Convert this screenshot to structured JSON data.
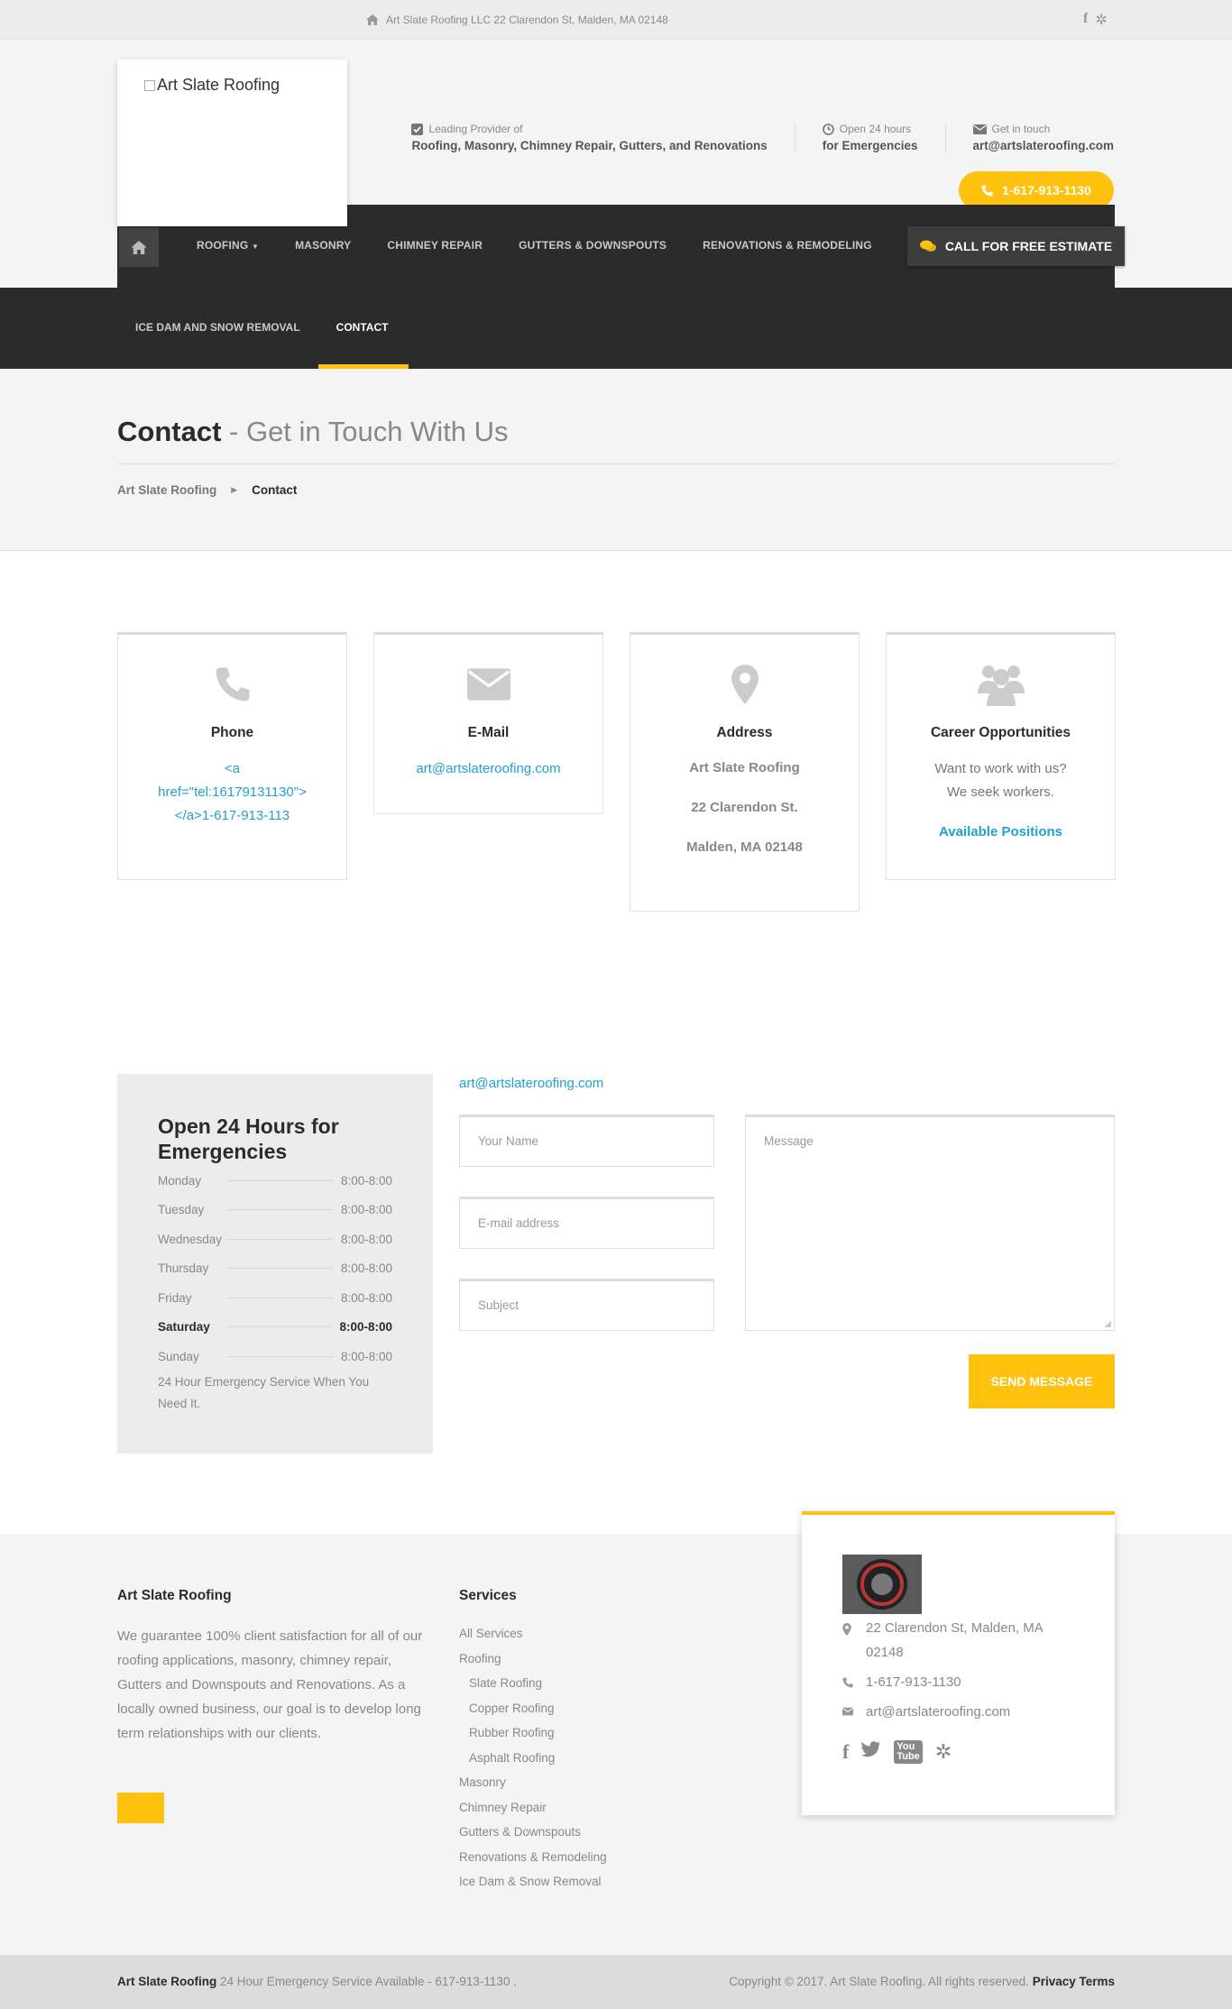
{
  "topbar": {
    "address": "Art Slate Roofing LLC 22 Clarendon St, Malden, MA 02148",
    "social_icons": [
      "facebook-icon",
      "yelp-icon"
    ]
  },
  "header": {
    "logo_alt": "Art Slate Roofing",
    "info": [
      {
        "icon": "checkbox-icon",
        "small": "Leading Provider of",
        "big": "Roofing, Masonry, Chimney Repair, Gutters, and Renovations"
      },
      {
        "icon": "clock-icon",
        "small": "Open 24 hours",
        "big": "for Emergencies"
      },
      {
        "icon": "envelope-icon",
        "small": "Get in touch",
        "big": "art@artslateroofing.com"
      }
    ],
    "phone_button": "1-617-913-1130"
  },
  "nav": {
    "items": [
      "ROOFING",
      "MASONRY",
      "CHIMNEY REPAIR",
      "GUTTERS & DOWNSPOUTS",
      "RENOVATIONS & REMODELING"
    ],
    "estimate_button": "CALL FOR FREE ESTIMATE",
    "row2": [
      "ICE DAM AND SNOW REMOVAL",
      "CONTACT"
    ]
  },
  "page": {
    "title_bold": "Contact",
    "title_sub": "- Get in Touch With Us",
    "breadcrumb": [
      "Art Slate Roofing",
      "Contact"
    ]
  },
  "cards": {
    "phone": {
      "title": "Phone",
      "l1": "<a",
      "l2": "href=\"tel:16179131130\">",
      "l3": "</a>1-617-913-113"
    },
    "email": {
      "title": "E-Mail",
      "value": "art@artslateroofing.com"
    },
    "address": {
      "title": "Address",
      "l1": "Art Slate Roofing",
      "l2": "22 Clarendon St.",
      "l3": "Malden, MA 02148"
    },
    "career": {
      "title": "Career Opportunities",
      "l1": "Want to work with us?",
      "l2": "We seek workers.",
      "link": "Available Positions"
    }
  },
  "hours": {
    "title": "Open 24 Hours for Emergencies",
    "rows": [
      {
        "day": "Monday",
        "time": "8:00-8:00"
      },
      {
        "day": "Tuesday",
        "time": "8:00-8:00"
      },
      {
        "day": "Wednesday",
        "time": "8:00-8:00"
      },
      {
        "day": "Thursday",
        "time": "8:00-8:00"
      },
      {
        "day": "Friday",
        "time": "8:00-8:00"
      },
      {
        "day": "Saturday",
        "time": "8:00-8:00"
      },
      {
        "day": "Sunday",
        "time": "8:00-8:00"
      }
    ],
    "highlighted_day": "Saturday",
    "note": "24 Hour Emergency Service When You Need It."
  },
  "form": {
    "email": "art@artslateroofing.com",
    "name_placeholder": "Your Name",
    "email_placeholder": "E-mail address",
    "subject_placeholder": "Subject",
    "message_placeholder": "Message",
    "send_button": "SEND MESSAGE"
  },
  "footer": {
    "about_title": "Art Slate Roofing",
    "about_text": "We guarantee 100% client satisfaction for all of our roofing applications, masonry, chimney repair, Gutters and Downspouts and Renovations. As a locally owned business, our goal is to develop long term relationships with our clients.",
    "services_title": "Services",
    "services": [
      {
        "label": "All Services",
        "sub": false
      },
      {
        "label": "Roofing",
        "sub": false
      },
      {
        "label": "Slate Roofing",
        "sub": true
      },
      {
        "label": "Copper Roofing",
        "sub": true
      },
      {
        "label": "Rubber Roofing",
        "sub": true
      },
      {
        "label": "Asphalt Roofing",
        "sub": true
      },
      {
        "label": "Masonry",
        "sub": false
      },
      {
        "label": "Chimney Repair",
        "sub": false
      },
      {
        "label": "Gutters & Downspouts",
        "sub": false
      },
      {
        "label": "Renovations & Remodeling",
        "sub": false
      },
      {
        "label": "Ice Dam & Snow Removal",
        "sub": false
      }
    ],
    "contact_address": "22 Clarendon St, Malden, MA 02148",
    "contact_phone": "1-617-913-1130",
    "contact_email": "art@artslateroofing.com",
    "socials": [
      "facebook-icon",
      "twitter-icon",
      "youtube-icon",
      "yelp-icon"
    ]
  },
  "bottom": {
    "brand": "Art Slate Roofing",
    "tagline": "24 Hour Emergency Service Available - 617-913-1130 .",
    "copyright": "Copyright © 2017. Art Slate Roofing. All rights reserved.",
    "links": "Privacy Terms"
  },
  "colors": {
    "accent": "#fec10e",
    "link": "#1fa2d0",
    "dark": "#2b2b2b"
  }
}
